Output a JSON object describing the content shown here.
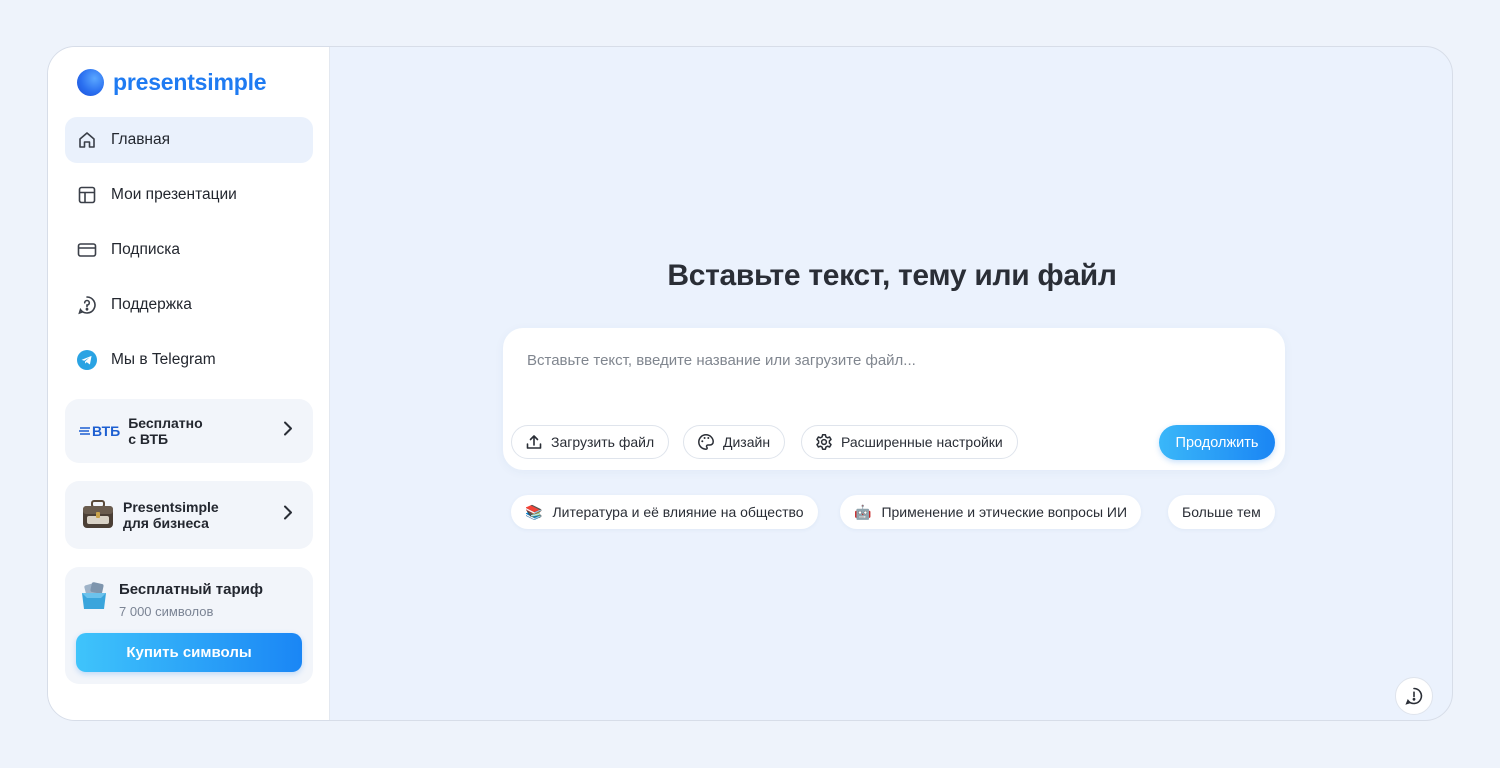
{
  "app": {
    "brand": "presentsimple"
  },
  "sidebar": {
    "items": [
      {
        "label": "Главная",
        "icon": "home-icon",
        "active": true
      },
      {
        "label": "Мои презентации",
        "icon": "layout-icon"
      },
      {
        "label": "Подписка",
        "icon": "card-icon"
      },
      {
        "label": "Поддержка",
        "icon": "help-icon"
      },
      {
        "label": "Мы в Telegram",
        "icon": "telegram-icon"
      }
    ],
    "promo_vtb": {
      "logo": "ВТБ",
      "line1": "Бесплатно",
      "line2": "с ВТБ"
    },
    "promo_business": {
      "line1": "Presentsimple",
      "line2": "для бизнеса"
    },
    "tariff": {
      "title": "Бесплатный тариф",
      "subtitle": "7 000 символов",
      "buy_label": "Купить символы"
    }
  },
  "main": {
    "title": "Вставьте текст, тему или файл",
    "input": {
      "placeholder": "Вставьте текст, введите название или загрузите файл...",
      "value": ""
    },
    "actions": {
      "upload": "Загрузить файл",
      "design": "Дизайн",
      "settings": "Расширенные настройки",
      "continue": "Продолжить"
    },
    "topics": [
      {
        "emoji": "📚",
        "label": "Литература и её влияние на общество"
      },
      {
        "emoji": "🤖",
        "label": "Применение и этические вопросы ИИ"
      },
      {
        "label": "Больше тем"
      }
    ]
  },
  "colors": {
    "accent": "#1f7bf2",
    "background": "#ebf2fd",
    "telegram": "#2aa3e3"
  }
}
